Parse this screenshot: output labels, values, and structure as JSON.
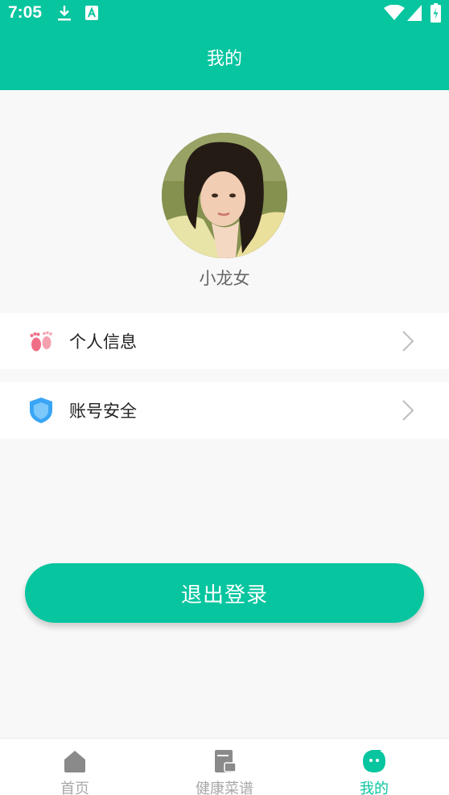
{
  "status_bar": {
    "time": "7:05",
    "icons": [
      "download-icon",
      "a-badge-icon",
      "wifi-icon",
      "signal-icon",
      "battery-charging-icon"
    ]
  },
  "header": {
    "title": "我的"
  },
  "profile": {
    "username": "小龙女",
    "avatar": "avatar-photo"
  },
  "menu": [
    {
      "label": "个人信息",
      "icon": "footprints-icon",
      "icon_color": "#f06e87"
    },
    {
      "label": "账号安全",
      "icon": "shield-icon",
      "icon_color": "#3aa5f5"
    }
  ],
  "logout": {
    "label": "退出登录"
  },
  "bottom_nav": [
    {
      "label": "首页",
      "icon": "home-icon",
      "active": false
    },
    {
      "label": "健康菜谱",
      "icon": "menu-book-icon",
      "active": false
    },
    {
      "label": "我的",
      "icon": "chat-bubble-icon",
      "active": true
    }
  ],
  "colors": {
    "accent": "#07c59f",
    "inactive": "#a8a8a8",
    "background": "#f8f8f8"
  }
}
